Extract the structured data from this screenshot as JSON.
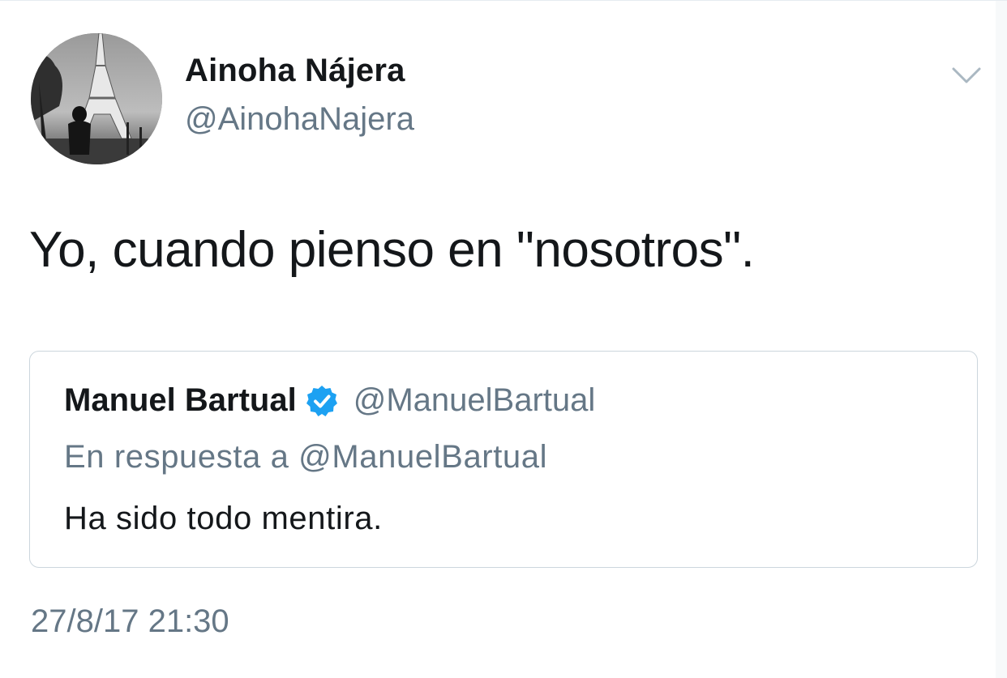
{
  "tweet": {
    "author_name": "Ainoha Nájera",
    "author_handle": "@AinohaNajera",
    "text": "Yo, cuando pienso en \"nosotros\".",
    "timestamp": "27/8/17 21:30",
    "avatar_icon": "avatar-photo-eiffel-tower",
    "menu_icon": "chevron-down-icon"
  },
  "quoted_tweet": {
    "author_name": "Manuel Bartual",
    "verified_icon": "verified-badge-icon",
    "author_handle": "@ManuelBartual",
    "reply_context": "En respuesta a @ManuelBartual",
    "text": "Ha sido todo mentira."
  },
  "colors": {
    "primary_text": "#14171a",
    "secondary_text": "#657786",
    "border": "#ccd6dd",
    "verified_blue": "#1da1f2"
  }
}
